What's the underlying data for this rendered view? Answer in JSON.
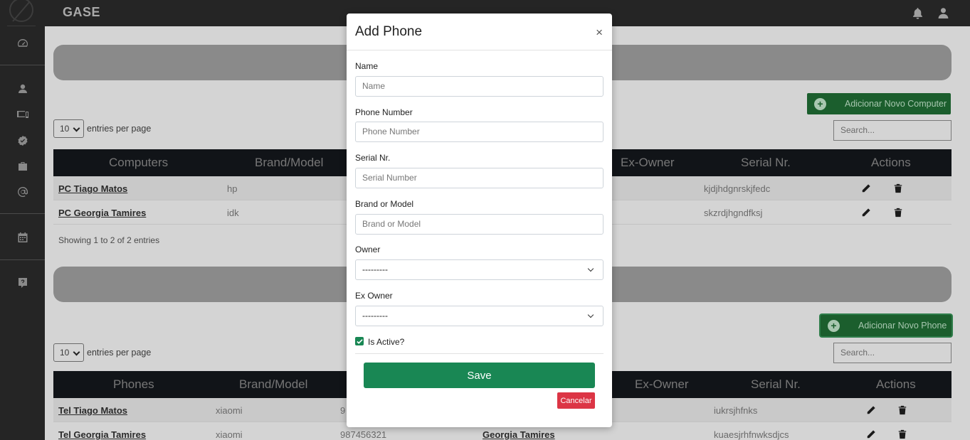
{
  "app": {
    "brand": "GASE"
  },
  "sidebar": {
    "icons": [
      "dashboard-icon",
      "user-icon",
      "devices-icon",
      "certificate-icon",
      "briefcase-icon",
      "at-icon",
      "calendar-icon",
      "help-icon"
    ]
  },
  "topbar": {
    "icons": [
      "bell-icon",
      "user-icon"
    ]
  },
  "computers": {
    "add_button": "Adicionar Novo Computer",
    "search_placeholder": "Search...",
    "entries_value": "10",
    "entries_label": "entries per page",
    "columns": [
      "Computers",
      "Brand/Model",
      "Ex-Owner",
      "Serial Nr.",
      "Actions"
    ],
    "rows": [
      {
        "name": "PC Tiago Matos",
        "brand": "hp",
        "serial": "kjdjhdgnrskjfedc"
      },
      {
        "name": "PC Georgia Tamires",
        "brand": "idk",
        "serial": "skzrdjhgndfksj"
      }
    ],
    "info": "Showing 1 to 2 of 2 entries"
  },
  "phones": {
    "add_button": "Adicionar Novo Phone",
    "search_placeholder": "Search...",
    "entries_value": "10",
    "entries_label": "entries per page",
    "columns": [
      "Phones",
      "Brand/Model",
      "Ex-Owner",
      "Serial Nr.",
      "Actions"
    ],
    "rows": [
      {
        "name": "Tel Tiago Matos",
        "brand": "xiaomi",
        "number": "9",
        "owner": "",
        "serial": "iukrsjhfnks"
      },
      {
        "name": "Tel Georgia Tamires",
        "brand": "xiaomi",
        "number": "987456321",
        "owner": "Georgia Tamires",
        "serial": "kuaesjrhfnwksdjcs"
      }
    ]
  },
  "modal": {
    "title": "Add Phone",
    "close": "×",
    "fields": {
      "name": {
        "label": "Name",
        "placeholder": "Name"
      },
      "phone_number": {
        "label": "Phone Number",
        "placeholder": "Phone Number"
      },
      "serial": {
        "label": "Serial Nr.",
        "placeholder": "Serial Number"
      },
      "brand": {
        "label": "Brand or Model",
        "placeholder": "Brand or Model"
      },
      "owner": {
        "label": "Owner",
        "value": "---------"
      },
      "ex_owner": {
        "label": "Ex Owner",
        "value": "---------"
      }
    },
    "is_active": {
      "label": "Is Active?",
      "checked": true
    },
    "save_label": "Save",
    "cancel_label": "Cancelar"
  },
  "colors": {
    "sidebar_bg": "#252525",
    "primary_green": "#198754",
    "danger_red": "#dc3545",
    "table_header": "#111418"
  }
}
